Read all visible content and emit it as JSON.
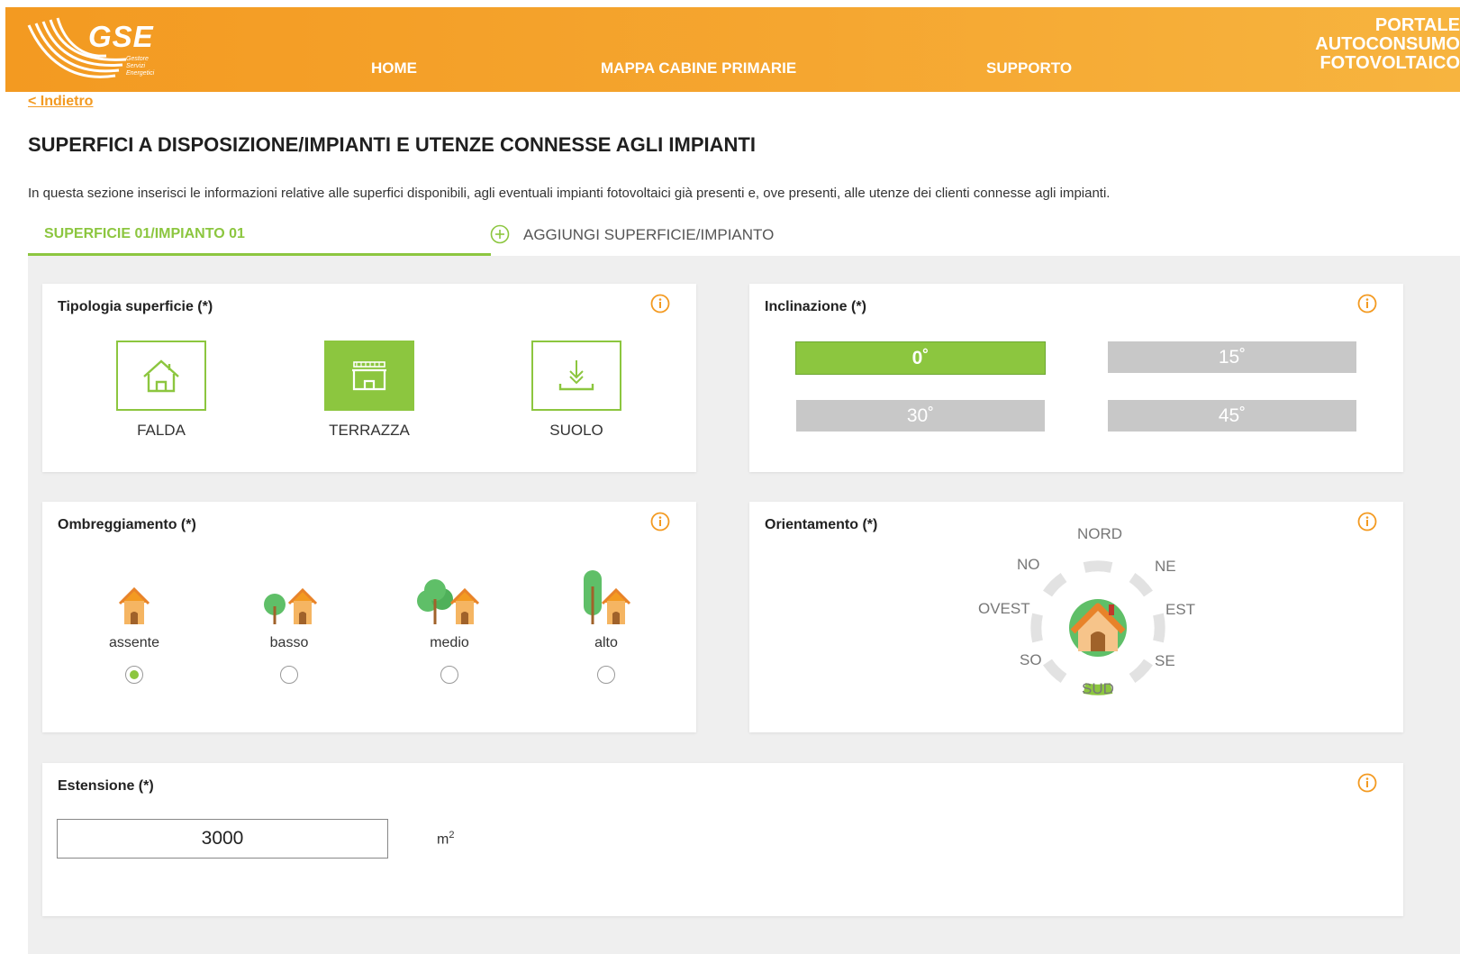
{
  "header": {
    "logo_text": "GSE",
    "logo_sub": [
      "Gestore",
      "Servizi",
      "Energetici"
    ],
    "nav": [
      "HOME",
      "MAPPA CABINE PRIMARIE",
      "SUPPORTO"
    ],
    "portal_title": "PORTALE\nAUTOCONSUMO\nFOTOVOLTAICO"
  },
  "back_link": "< Indietro",
  "page_title": "SUPERFICI A DISPOSIZIONE/IMPIANTI E UTENZE CONNESSE AGLI IMPIANTI",
  "page_description": "In questa sezione inserisci le informazioni relative alle superfici disponibili, agli eventuali impianti fotovoltaici già presenti e, ove presenti, alle utenze dei clienti connesse agli impianti.",
  "tabs": {
    "active": "SUPERFICIE 01/IMPIANTO 01",
    "add": "AGGIUNGI SUPERFICIE/IMPIANTO"
  },
  "tipologia": {
    "title": "Tipologia superficie (*)",
    "options": [
      "FALDA",
      "TERRAZZA",
      "SUOLO"
    ],
    "selected": "TERRAZZA"
  },
  "inclinazione": {
    "title": "Inclinazione (*)",
    "options": [
      "0˚",
      "15˚",
      "30˚",
      "45˚"
    ],
    "selected": "0˚"
  },
  "ombreggiamento": {
    "title": "Ombreggiamento (*)",
    "options": [
      "assente",
      "basso",
      "medio",
      "alto"
    ],
    "selected": "assente"
  },
  "orientamento": {
    "title": "Orientamento (*)",
    "directions": {
      "n": "NORD",
      "ne": "NE",
      "e": "EST",
      "se": "SE",
      "s": "SUD",
      "so": "SO",
      "o": "OVEST",
      "no": "NO"
    },
    "selected": "SUD"
  },
  "estensione": {
    "title": "Estensione (*)",
    "value": "3000",
    "unit": "m",
    "unit_exp": "2"
  },
  "colors": {
    "accent_orange": "#f39a21",
    "accent_green": "#8cc63f",
    "inactive_grey": "#c8c8c8"
  }
}
